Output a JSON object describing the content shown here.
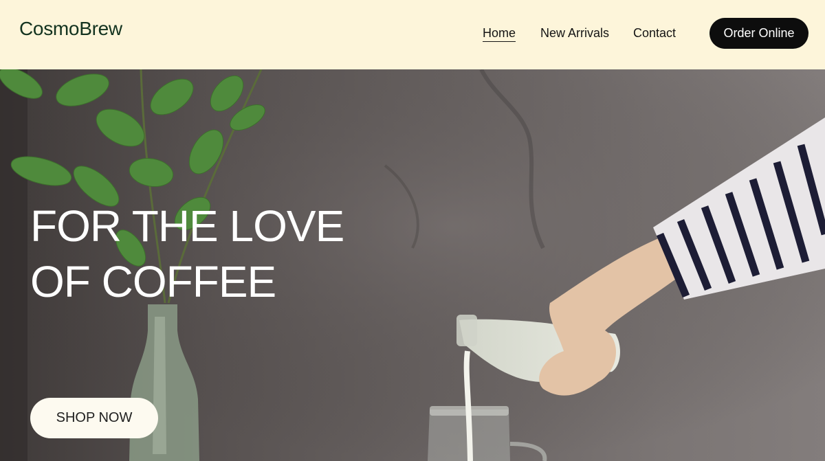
{
  "brand": {
    "name": "CosmoBrew"
  },
  "nav": {
    "items": [
      {
        "label": "Home",
        "active": true
      },
      {
        "label": "New Arrivals"
      },
      {
        "label": "Contact"
      }
    ],
    "cta_label": "Order Online"
  },
  "hero": {
    "title_line1": "FOR THE LOVE",
    "title_line2": "OF COFFEE",
    "button_label": "SHOP NOW",
    "image_description_icon": "milk-pour-photo"
  },
  "colors": {
    "header_bg": "#fdf5da",
    "logo": "#13331f",
    "cta_bg": "#0d0d0d",
    "hero_wall": "#6a6463",
    "leaf_green": "#4f8a3c"
  }
}
